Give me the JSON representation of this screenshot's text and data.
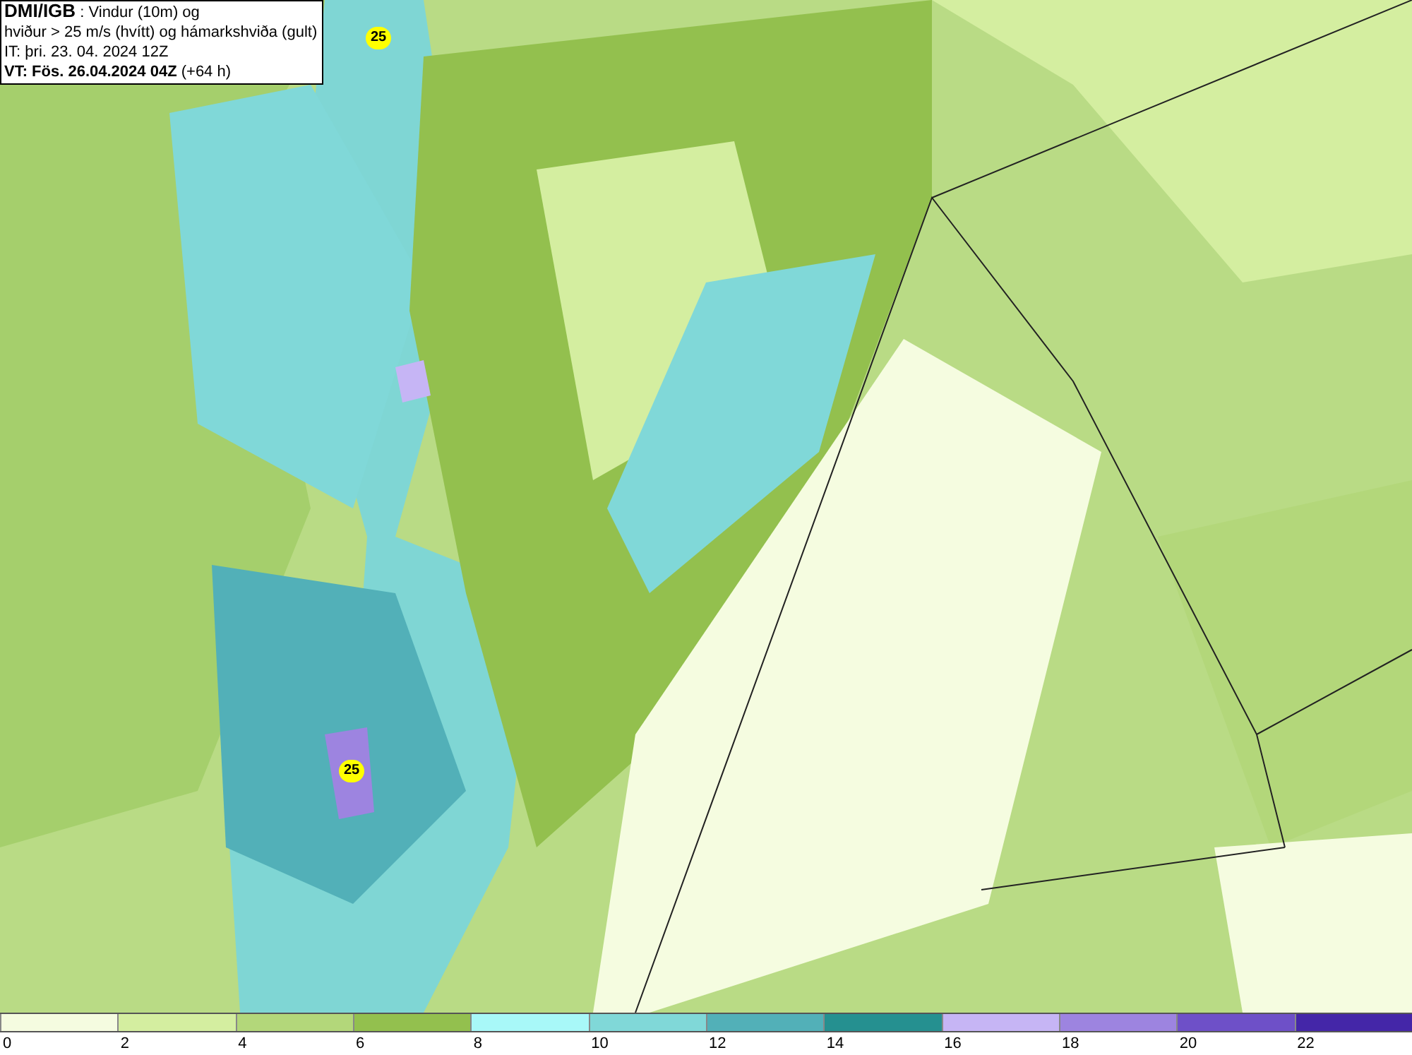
{
  "info_box": {
    "source": "DMI/IGB",
    "title_rest": " : Vindur (10m) og",
    "line_2": "hviður > 25 m/s (hvítt) og hámarkshviða (gult)",
    "line_3": "IT: þri. 23. 04. 2024 12Z",
    "valid_time": "VT: Fös. 26.04.2024 04Z",
    "lead": " (+64 h)"
  },
  "map": {
    "markers": [
      {
        "label": "25"
      },
      {
        "label": "25"
      }
    ]
  },
  "legend": {
    "segments": [
      {
        "color": "#f5fce0",
        "label": "0"
      },
      {
        "color": "#d4eea0",
        "label": "2"
      },
      {
        "color": "#b3d77a",
        "label": "4"
      },
      {
        "color": "#93c04e",
        "label": "6"
      },
      {
        "color": "#a8f8f8",
        "label": "8"
      },
      {
        "color": "#80d8d8",
        "label": "10"
      },
      {
        "color": "#52b0b8",
        "label": "12"
      },
      {
        "color": "#259090",
        "label": "14"
      },
      {
        "color": "#c6b5f5",
        "label": "16"
      },
      {
        "color": "#9d84e0",
        "label": "18"
      },
      {
        "color": "#6e50c8",
        "label": "20"
      },
      {
        "color": "#4426a8",
        "label": "22"
      }
    ]
  }
}
